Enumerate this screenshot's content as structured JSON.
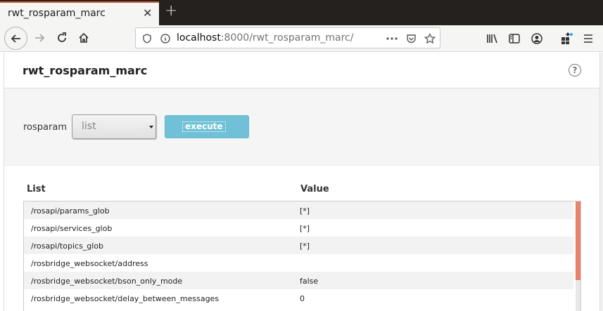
{
  "browser": {
    "tab_title": "rwt_rosparam_marc",
    "url_host": "localhost",
    "url_rest": ":8000/rwt_rosparam_marc/"
  },
  "app": {
    "title": "rwt_rosparam_marc",
    "rosparam_label": "rosparam",
    "select_value": "list",
    "execute_label": "execute"
  },
  "table": {
    "headers": [
      "List",
      "Value"
    ],
    "rows": [
      {
        "key": "/rosapi/params_glob",
        "value": "[*]"
      },
      {
        "key": "/rosapi/services_glob",
        "value": "[*]"
      },
      {
        "key": "/rosapi/topics_glob",
        "value": "[*]"
      },
      {
        "key": "/rosbridge_websocket/address",
        "value": ""
      },
      {
        "key": "/rosbridge_websocket/bson_only_mode",
        "value": "false"
      },
      {
        "key": "/rosbridge_websocket/delay_between_messages",
        "value": "0"
      }
    ]
  },
  "colors": {
    "accent_tab": "#d15937",
    "execute_button": "#70c1d8",
    "scroll_thumb": "#e8826a"
  }
}
